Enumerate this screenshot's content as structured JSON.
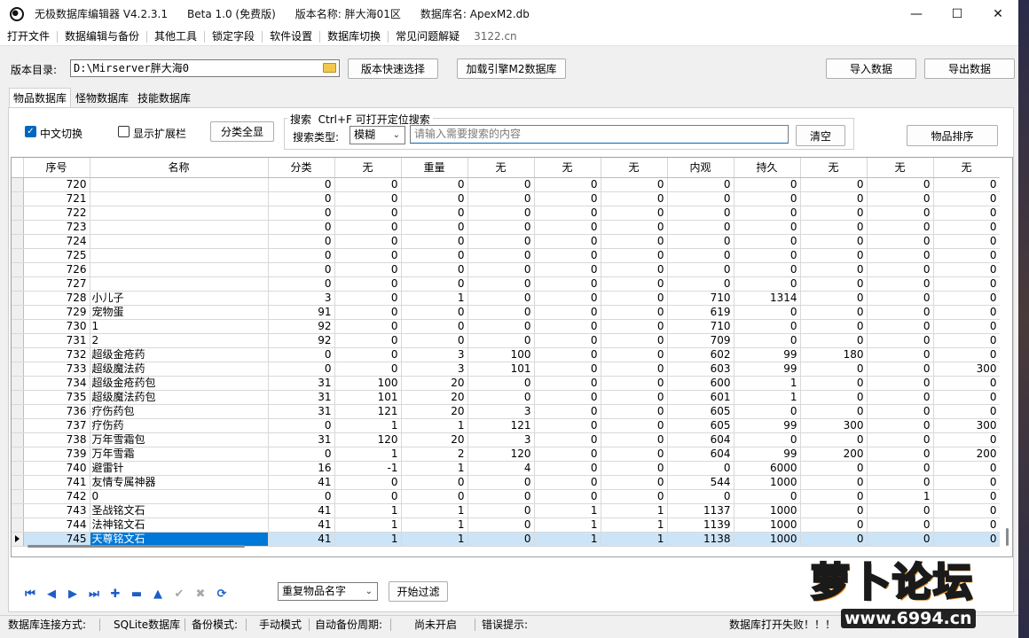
{
  "titlebar": {
    "app_name": "无极数据库编辑器 V4.2.3.1",
    "edition": "Beta 1.0 (免费版)",
    "version_name": "版本名称: 胖大海01区",
    "db_name": "数据库名: ApexM2.db"
  },
  "menu": [
    "打开文件",
    "数据编辑与备份",
    "其他工具",
    "锁定字段",
    "软件设置",
    "数据库切换",
    "常见问题解疑"
  ],
  "menu_site": "3122.cn",
  "toolbar": {
    "dir_label": "版本目录:",
    "dir_value": "D:\\Mirserver胖大海0",
    "quick_select": "版本快速选择",
    "load_engine": "加载引擎M2数据库",
    "import": "导入数据",
    "export": "导出数据"
  },
  "tabs": [
    "物品数据库",
    "怪物数据库",
    "技能数据库"
  ],
  "panel": {
    "chinese_toggle": "中文切换",
    "show_ext": "显示扩展栏",
    "show_all": "分类全显",
    "search_legend": "搜索  Ctrl+F 可打开定位搜索",
    "search_type_label": "搜索类型:",
    "search_type_value": "模糊",
    "search_placeholder": "请输入需要搜索的内容",
    "clear": "清空",
    "sort": "物品排序"
  },
  "grid": {
    "columns": [
      "序号",
      "名称",
      "分类",
      "无",
      "重量",
      "无",
      "无",
      "无",
      "内观",
      "持久",
      "无",
      "无",
      "无"
    ],
    "rows": [
      [
        "720",
        "",
        "0",
        "0",
        "0",
        "0",
        "0",
        "0",
        "0",
        "0",
        "0",
        "0",
        "0"
      ],
      [
        "721",
        "",
        "0",
        "0",
        "0",
        "0",
        "0",
        "0",
        "0",
        "0",
        "0",
        "0",
        "0"
      ],
      [
        "722",
        "",
        "0",
        "0",
        "0",
        "0",
        "0",
        "0",
        "0",
        "0",
        "0",
        "0",
        "0"
      ],
      [
        "723",
        "",
        "0",
        "0",
        "0",
        "0",
        "0",
        "0",
        "0",
        "0",
        "0",
        "0",
        "0"
      ],
      [
        "724",
        "",
        "0",
        "0",
        "0",
        "0",
        "0",
        "0",
        "0",
        "0",
        "0",
        "0",
        "0"
      ],
      [
        "725",
        "",
        "0",
        "0",
        "0",
        "0",
        "0",
        "0",
        "0",
        "0",
        "0",
        "0",
        "0"
      ],
      [
        "726",
        "",
        "0",
        "0",
        "0",
        "0",
        "0",
        "0",
        "0",
        "0",
        "0",
        "0",
        "0"
      ],
      [
        "727",
        "",
        "0",
        "0",
        "0",
        "0",
        "0",
        "0",
        "0",
        "0",
        "0",
        "0",
        "0"
      ],
      [
        "728",
        "小儿子",
        "3",
        "0",
        "1",
        "0",
        "0",
        "0",
        "710",
        "1314",
        "0",
        "0",
        "0"
      ],
      [
        "729",
        "宠物蛋",
        "91",
        "0",
        "0",
        "0",
        "0",
        "0",
        "619",
        "0",
        "0",
        "0",
        "0"
      ],
      [
        "730",
        "1",
        "92",
        "0",
        "0",
        "0",
        "0",
        "0",
        "710",
        "0",
        "0",
        "0",
        "0"
      ],
      [
        "731",
        "2",
        "92",
        "0",
        "0",
        "0",
        "0",
        "0",
        "709",
        "0",
        "0",
        "0",
        "0"
      ],
      [
        "732",
        "超级金疮药",
        "0",
        "0",
        "3",
        "100",
        "0",
        "0",
        "602",
        "99",
        "180",
        "0",
        "0"
      ],
      [
        "733",
        "超级魔法药",
        "0",
        "0",
        "3",
        "101",
        "0",
        "0",
        "603",
        "99",
        "0",
        "0",
        "300"
      ],
      [
        "734",
        "超级金疮药包",
        "31",
        "100",
        "20",
        "0",
        "0",
        "0",
        "600",
        "1",
        "0",
        "0",
        "0"
      ],
      [
        "735",
        "超级魔法药包",
        "31",
        "101",
        "20",
        "0",
        "0",
        "0",
        "601",
        "1",
        "0",
        "0",
        "0"
      ],
      [
        "736",
        "疗伤药包",
        "31",
        "121",
        "20",
        "3",
        "0",
        "0",
        "605",
        "0",
        "0",
        "0",
        "0"
      ],
      [
        "737",
        "疗伤药",
        "0",
        "1",
        "1",
        "121",
        "0",
        "0",
        "605",
        "99",
        "300",
        "0",
        "300"
      ],
      [
        "738",
        "万年雪霜包",
        "31",
        "120",
        "20",
        "3",
        "0",
        "0",
        "604",
        "0",
        "0",
        "0",
        "0"
      ],
      [
        "739",
        "万年雪霜",
        "0",
        "1",
        "2",
        "120",
        "0",
        "0",
        "604",
        "99",
        "200",
        "0",
        "200"
      ],
      [
        "740",
        "避雷针",
        "16",
        "-1",
        "1",
        "4",
        "0",
        "0",
        "0",
        "6000",
        "0",
        "0",
        "0"
      ],
      [
        "741",
        "友情专属神器",
        "41",
        "0",
        "0",
        "0",
        "0",
        "0",
        "544",
        "1000",
        "0",
        "0",
        "0"
      ],
      [
        "742",
        "0",
        "0",
        "0",
        "0",
        "0",
        "0",
        "0",
        "0",
        "0",
        "0",
        "1",
        "0"
      ],
      [
        "743",
        "圣战铭文石",
        "41",
        "1",
        "1",
        "0",
        "1",
        "1",
        "1137",
        "1000",
        "0",
        "0",
        "0"
      ],
      [
        "744",
        "法神铭文石",
        "41",
        "1",
        "1",
        "0",
        "1",
        "1",
        "1139",
        "1000",
        "0",
        "0",
        "0"
      ],
      [
        "745",
        "天尊铭文石",
        "41",
        "1",
        "1",
        "0",
        "1",
        "1",
        "1138",
        "1000",
        "0",
        "0",
        "0"
      ]
    ],
    "selected_index": 25
  },
  "bottom": {
    "dup_select": "重复物品名字",
    "start_filter": "开始过滤"
  },
  "statusbar": {
    "conn_label": "数据库连接方式:",
    "conn_value": "SQLite数据库",
    "backup_label": "备份模式:",
    "backup_value": "手动模式",
    "auto_label": "自动备份周期:",
    "auto_value": "尚未开启",
    "err_label": "错误提示:",
    "err_value": "数据库打开失败！！！"
  },
  "watermark": {
    "title": "萝卜论坛",
    "url": "www.6994.cn"
  }
}
